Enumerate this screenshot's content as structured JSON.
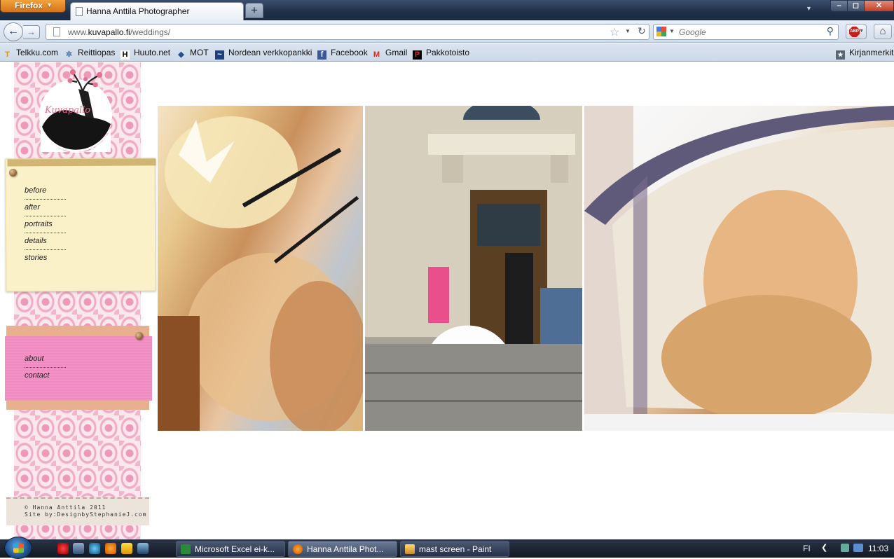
{
  "browser": {
    "app_button": "Firefox",
    "tab_title": "Hanna Anttila Photographer",
    "new_tab": "+",
    "url_prefix": "www.",
    "url_domain": "kuvapallo.fi",
    "url_path": "/weddings/",
    "search_placeholder": "Google",
    "home_icon": "home-icon"
  },
  "bookmarks": [
    {
      "label": "Telkku.com",
      "icon": "telkku-icon"
    },
    {
      "label": "Reittiopas",
      "icon": "gear-icon"
    },
    {
      "label": "Huuto.net",
      "icon": "huuto-icon"
    },
    {
      "label": "MOT",
      "icon": "book-icon"
    },
    {
      "label": "Nordean verkkopankki",
      "icon": "nordea-icon"
    },
    {
      "label": "Facebook",
      "icon": "facebook-icon"
    },
    {
      "label": "Gmail",
      "icon": "gmail-icon"
    },
    {
      "label": "Pakkotoisto",
      "icon": "pakkotoisto-icon"
    },
    {
      "label": "Kirjanmerkit",
      "icon": "bookmarks-icon"
    }
  ],
  "site": {
    "logo_text": "Kuvapallo",
    "menu_main": [
      "before",
      "after",
      "portraits",
      "details",
      "stories"
    ],
    "menu_secondary": [
      "about",
      "contact"
    ],
    "footer_line1": "© Hanna Anttila 2011",
    "footer_line2": "Site by:DesignbyStephanieJ.com",
    "photos": [
      {
        "name": "bride-makeup-photo"
      },
      {
        "name": "church-steps-photo"
      },
      {
        "name": "bride-car-window-photo"
      }
    ]
  },
  "taskbar": {
    "tasks": [
      {
        "label": "Microsoft Excel ei-k..."
      },
      {
        "label": "Hanna Anttila Phot..."
      },
      {
        "label": "mast screen - Paint"
      }
    ],
    "language": "FI",
    "clock": "11:03"
  },
  "colors": {
    "damask_pink": "#ec9ab8",
    "note_yellow": "#fbf1c9",
    "card_pink": "#f08ac0",
    "firefox_orange": "#e08a2a"
  }
}
